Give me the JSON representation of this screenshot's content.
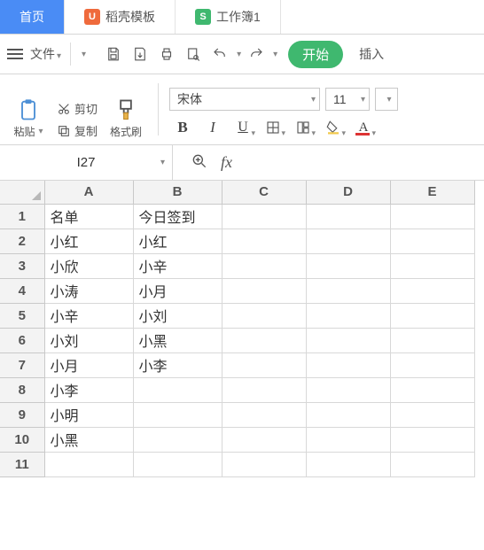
{
  "tabs": {
    "home": "首页",
    "template_badge": "U",
    "template": "稻壳模板",
    "book_badge": "S",
    "book": "工作簿1"
  },
  "toolbar": {
    "file": "文件",
    "start": "开始",
    "insert": "插入"
  },
  "ribbon": {
    "paste": "粘贴",
    "cut": "剪切",
    "copy": "复制",
    "format_painter": "格式刷",
    "font_name": "宋体",
    "font_size": "11"
  },
  "fx": {
    "namebox": "I27",
    "fx_label": "fx"
  },
  "grid": {
    "cols": [
      "A",
      "B",
      "C",
      "D",
      "E"
    ],
    "rows": [
      "1",
      "2",
      "3",
      "4",
      "5",
      "6",
      "7",
      "8",
      "9",
      "10",
      "11"
    ],
    "data": {
      "A": [
        "名单",
        "小红",
        "小欣",
        "小涛",
        "小辛",
        "小刘",
        "小月",
        "小李",
        "小明",
        "小黑",
        ""
      ],
      "B": [
        "今日签到",
        "小红",
        "小辛",
        "小月",
        "小刘",
        "小黑",
        "小李",
        "",
        "",
        "",
        ""
      ],
      "C": [
        "",
        "",
        "",
        "",
        "",
        "",
        "",
        "",
        "",
        "",
        ""
      ],
      "D": [
        "",
        "",
        "",
        "",
        "",
        "",
        "",
        "",
        "",
        "",
        ""
      ],
      "E": [
        "",
        "",
        "",
        "",
        "",
        "",
        "",
        "",
        "",
        "",
        ""
      ]
    }
  }
}
